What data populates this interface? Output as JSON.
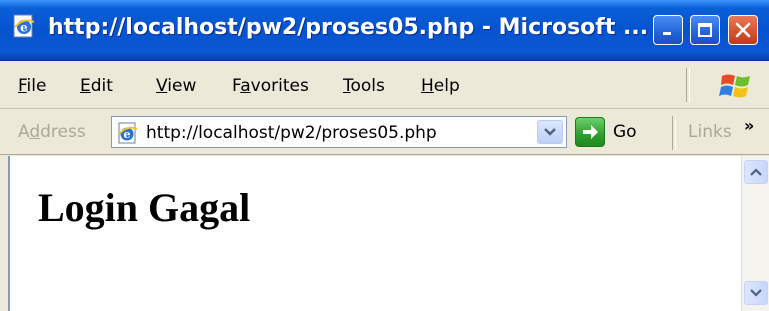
{
  "window": {
    "title": "http://localhost/pw2/proses05.php - Microsoft ...",
    "accent": "#0653cf"
  },
  "menu": {
    "items": [
      {
        "mnemonic": "F",
        "rest": "ile"
      },
      {
        "mnemonic": "E",
        "rest": "dit"
      },
      {
        "mnemonic": "V",
        "rest": "iew"
      },
      {
        "pre": "F",
        "mnemonic": "a",
        "rest": "vorites"
      },
      {
        "mnemonic": "T",
        "rest": "ools"
      },
      {
        "mnemonic": "H",
        "rest": "elp"
      }
    ]
  },
  "address_bar": {
    "label_pre": "A",
    "label_mnemonic": "d",
    "label_rest": "dress",
    "url": "http://localhost/pw2/proses05.php",
    "go_label": "Go",
    "links_label": "Links",
    "chevron": "»"
  },
  "page": {
    "heading": "Login Gagal"
  },
  "icons": {
    "app": "ie-page-icon",
    "logo": "windows-flag-icon",
    "go": "green-arrow-icon"
  }
}
